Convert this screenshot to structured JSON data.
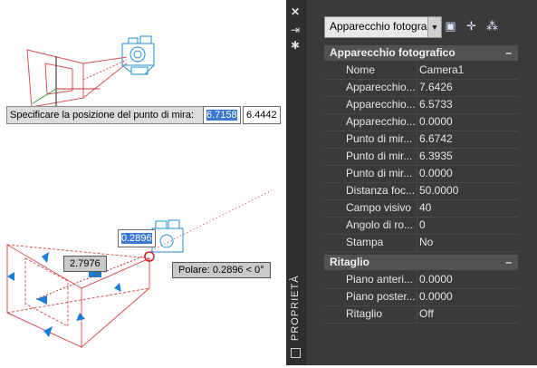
{
  "viewport": {
    "prompt_label": "Specificare la posizione del punto di mira:",
    "input_x": "6.7158",
    "input_y": "6.4442",
    "dyn_value": "0.2896",
    "dist_label": "2.7976",
    "polar_label": "Polare: 0.2896 < 0°"
  },
  "palette": {
    "side_title": "PROPRIETÀ",
    "dropdown_value": "Apparecchio fotogra...",
    "sections": [
      {
        "title": "Apparecchio fotografico",
        "rows": [
          {
            "key": "Nome",
            "value": "Camera1"
          },
          {
            "key": "Apparecchio...",
            "value": "7.6426"
          },
          {
            "key": "Apparecchio...",
            "value": "6.5733"
          },
          {
            "key": "Apparecchio...",
            "value": "0.0000"
          },
          {
            "key": "Punto di mir...",
            "value": "6.6742"
          },
          {
            "key": "Punto di mir...",
            "value": "6.3935"
          },
          {
            "key": "Punto di mir...",
            "value": "0.0000"
          },
          {
            "key": "Distanza foc...",
            "value": "50.0000"
          },
          {
            "key": "Campo visivo",
            "value": "40"
          },
          {
            "key": "Angolo di ro...",
            "value": "0"
          },
          {
            "key": "Stampa",
            "value": "No"
          }
        ]
      },
      {
        "title": "Ritaglio",
        "rows": [
          {
            "key": "Piano anteri...",
            "value": "0.0000"
          },
          {
            "key": "Piano poster...",
            "value": "0.0000"
          },
          {
            "key": "Ritaglio",
            "value": "Off"
          }
        ]
      }
    ],
    "collapse_symbol": "–"
  }
}
